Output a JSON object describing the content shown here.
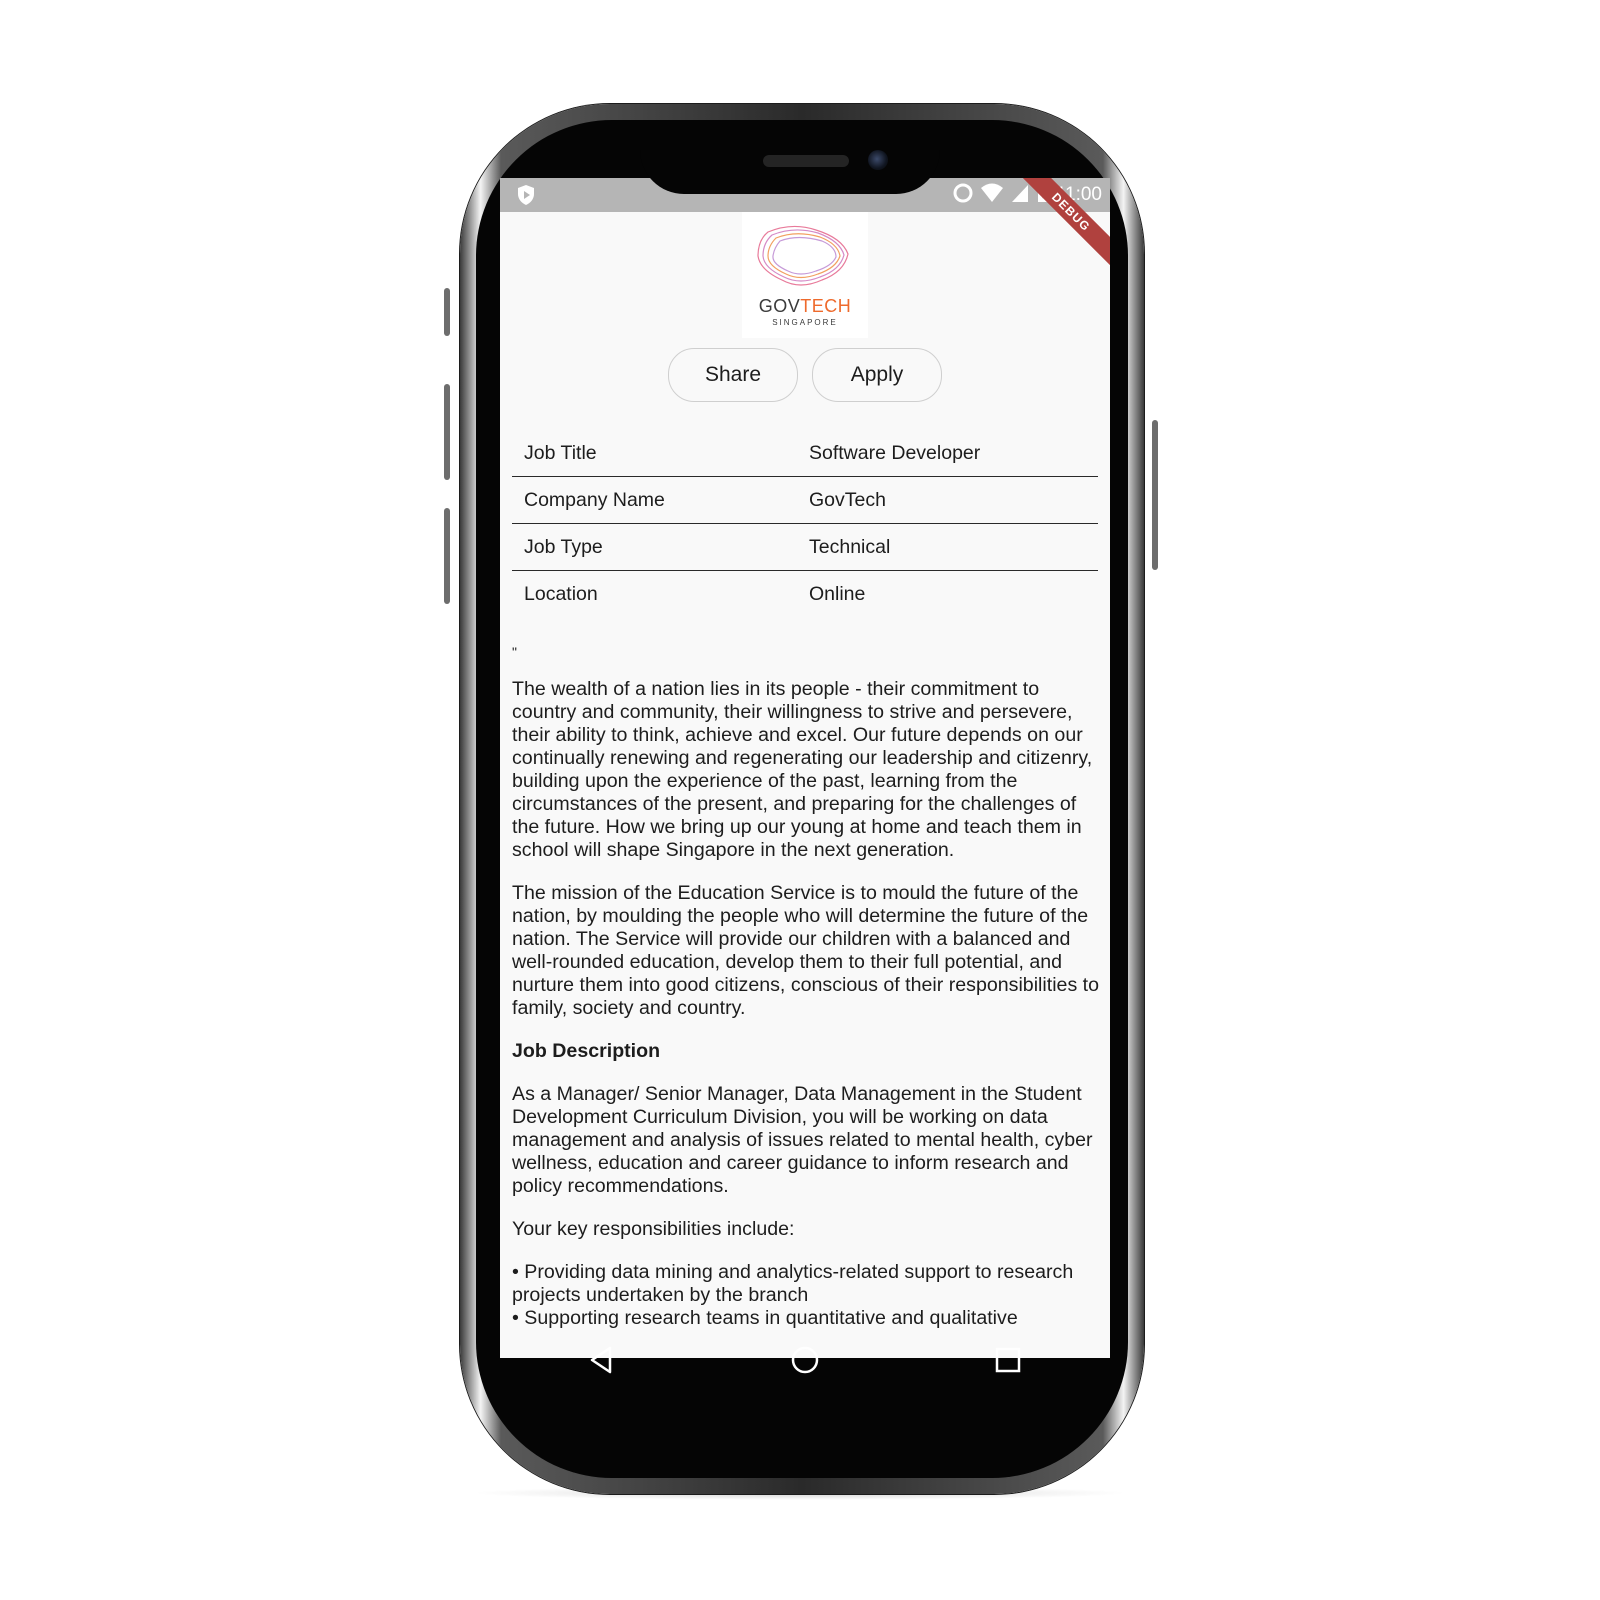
{
  "status_bar": {
    "time": "11:00",
    "debug_banner": "DEBUG"
  },
  "logo": {
    "word_gov": "GOV",
    "word_tech": "TECH",
    "subtitle": "SINGAPORE",
    "accent_color": "#ee6a2c"
  },
  "actions": {
    "share_label": "Share",
    "apply_label": "Apply"
  },
  "details": [
    {
      "label": "Job Title",
      "value": "Software Developer"
    },
    {
      "label": "Company Name",
      "value": "GovTech"
    },
    {
      "label": "Job Type",
      "value": "Technical"
    },
    {
      "label": "Location",
      "value": "Online"
    }
  ],
  "description": {
    "quote_mark": "\"",
    "intro_1": "The wealth of a nation lies in its people - their commitment to country and community, their willingness to strive and persevere, their ability to think, achieve and excel. Our future depends on our continually renewing and regenerating our leadership and citizenry, building upon the experience of the past, learning from the circumstances of the present, and preparing for the challenges of the future. How we bring up our young at home and teach them in school will shape Singapore in the next generation.",
    "intro_2": "The mission of the Education Service is to mould the future of the nation, by moulding the people who will determine the future of the nation. The Service will provide our children with a balanced and well-rounded education, develop them to their full potential, and nurture them into good citizens, conscious of their responsibilities to family, society and country.",
    "heading": "Job Description",
    "role": "As a Manager/ Senior Manager, Data Management in the Student Development Curriculum Division, you will be working on data management and analysis of issues related to mental health, cyber wellness, education and career guidance to inform research and policy recommendations.",
    "responsibilities_intro": "Your key responsibilities include:",
    "bullet_1": "• Providing data mining and analytics-related support to research projects undertaken by the branch",
    "bullet_2": "• Supporting research teams in quantitative and qualitative"
  },
  "nav": {
    "back_icon": "back-triangle-icon",
    "home_icon": "home-circle-icon",
    "recents_icon": "recents-square-icon"
  }
}
